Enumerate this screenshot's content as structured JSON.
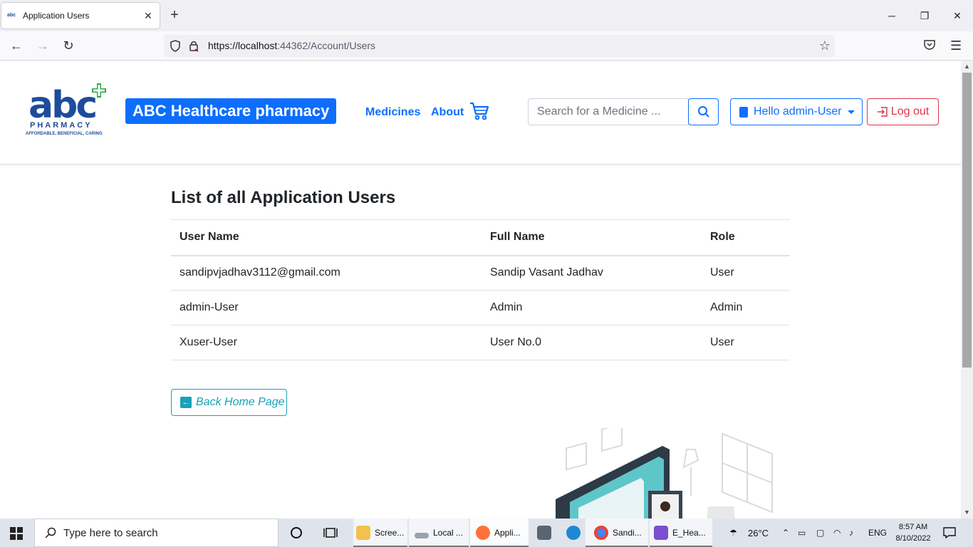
{
  "browser": {
    "tab_title": "Application Users",
    "url_host": "https://localhost",
    "url_rest": ":44362/Account/Users",
    "new_tab_symbol": "+",
    "window_controls": [
      "─",
      "❐",
      "✕"
    ]
  },
  "site": {
    "logo": {
      "abc": "abc",
      "pharmacy": "PHARMACY",
      "tagline": "AFFORDABLE, BENEFICIAL, CARING"
    },
    "brand": "ABC Healthcare pharmacy",
    "nav": {
      "medicines": "Medicines",
      "about": "About"
    },
    "search": {
      "placeholder": "Search for a Medicine ..."
    },
    "user_menu": "Hello admin-User",
    "logout": "Log out"
  },
  "main": {
    "heading": "List of all Application Users",
    "table": {
      "columns": [
        "User Name",
        "Full Name",
        "Role"
      ],
      "rows": [
        [
          "sandipvjadhav3112@gmail.com",
          "Sandip Vasant Jadhav",
          "User"
        ],
        [
          "admin-User",
          "Admin",
          "Admin"
        ],
        [
          "Xuser-User",
          "User No.0",
          "User"
        ]
      ]
    },
    "back_button": "Back Home Page"
  },
  "taskbar": {
    "search_text": "Type here to search",
    "apps": [
      {
        "label": "Scree...",
        "icon": "folder-icon",
        "color": "#f2c14e"
      },
      {
        "label": "Local ...",
        "icon": "drive-icon",
        "color": "#9aa3ad"
      },
      {
        "label": "Appli...",
        "icon": "firefox-icon",
        "color": "#ff7139"
      },
      {
        "label": "",
        "icon": "calendar-icon",
        "color": "#5b6472"
      },
      {
        "label": "",
        "icon": "edge-icon",
        "color": "#1e88d6"
      },
      {
        "label": "Sandi...",
        "icon": "chrome-icon",
        "color": "#4285f4"
      },
      {
        "label": "E_Hea...",
        "icon": "visual-studio-icon",
        "color": "#7b4fcf"
      }
    ],
    "weather": "26°C",
    "language": "ENG",
    "time": "8:57 AM",
    "date": "8/10/2022"
  },
  "colors": {
    "primary": "#0d6efd",
    "danger": "#dc3545",
    "info": "#17a2b8",
    "logo_blue": "#1d4c9c",
    "logo_green": "#2fa84f"
  }
}
